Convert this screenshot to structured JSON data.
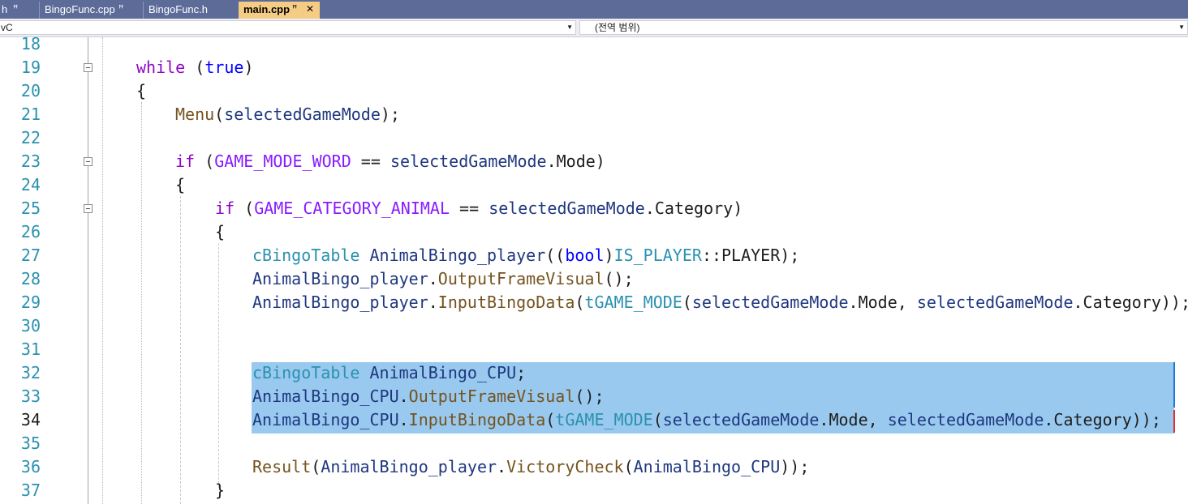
{
  "tabs": [
    {
      "label": "h",
      "pinned": true
    },
    {
      "label": "BingoFunc.cpp",
      "pinned": true
    },
    {
      "label": "BingoFunc.h",
      "pinned": false
    },
    {
      "label": "main.cpp",
      "pinned": true,
      "active": true,
      "close": "✕"
    }
  ],
  "navbar": {
    "scope_left": "vC",
    "scope_right": "(전역 범위)"
  },
  "colors": {
    "keyword": "#8f08c4",
    "keyword_blue": "#0000ff",
    "function": "#74531f",
    "type": "#2b91af",
    "macro": "#8a1bff",
    "variable": "#1f377f",
    "selection": "#99c9ef",
    "tab_active": "#f5cc84",
    "tab_bar": "#5d6b99"
  },
  "editor": {
    "current_line": "34",
    "lines": [
      {
        "num": "18",
        "tokens": []
      },
      {
        "num": "19",
        "tokens": [
          {
            "t": "while",
            "c": "kw"
          },
          {
            "t": " ("
          },
          {
            "t": "true",
            "c": "kwb"
          },
          {
            "t": ")"
          }
        ]
      },
      {
        "num": "20",
        "tokens": [
          {
            "t": "{"
          }
        ]
      },
      {
        "num": "21",
        "tokens": [
          {
            "t": "Menu",
            "c": "fn"
          },
          {
            "t": "("
          },
          {
            "t": "selectedGameMode",
            "c": "var"
          },
          {
            "t": ");"
          }
        ]
      },
      {
        "num": "22",
        "tokens": []
      },
      {
        "num": "23",
        "tokens": [
          {
            "t": "if",
            "c": "kw"
          },
          {
            "t": " ("
          },
          {
            "t": "GAME_MODE_WORD",
            "c": "mac"
          },
          {
            "t": " == "
          },
          {
            "t": "selectedGameMode",
            "c": "var"
          },
          {
            "t": ".Mode)"
          }
        ]
      },
      {
        "num": "24",
        "tokens": [
          {
            "t": "{"
          }
        ]
      },
      {
        "num": "25",
        "tokens": [
          {
            "t": "if",
            "c": "kw"
          },
          {
            "t": " ("
          },
          {
            "t": "GAME_CATEGORY_ANIMAL",
            "c": "mac"
          },
          {
            "t": " == "
          },
          {
            "t": "selectedGameMode",
            "c": "var"
          },
          {
            "t": ".Category)"
          }
        ]
      },
      {
        "num": "26",
        "tokens": [
          {
            "t": "{"
          }
        ]
      },
      {
        "num": "27",
        "tokens": [
          {
            "t": "cBingoTable",
            "c": "typ"
          },
          {
            "t": " "
          },
          {
            "t": "AnimalBingo_player",
            "c": "var"
          },
          {
            "t": "(("
          },
          {
            "t": "bool",
            "c": "kwb"
          },
          {
            "t": ")"
          },
          {
            "t": "IS_PLAYER",
            "c": "typ"
          },
          {
            "t": "::PLAYER);"
          }
        ]
      },
      {
        "num": "28",
        "tokens": [
          {
            "t": "AnimalBingo_player",
            "c": "var"
          },
          {
            "t": "."
          },
          {
            "t": "OutputFrameVisual",
            "c": "fn"
          },
          {
            "t": "();"
          }
        ]
      },
      {
        "num": "29",
        "tokens": [
          {
            "t": "AnimalBingo_player",
            "c": "var"
          },
          {
            "t": "."
          },
          {
            "t": "InputBingoData",
            "c": "fn"
          },
          {
            "t": "("
          },
          {
            "t": "tGAME_MODE",
            "c": "typ"
          },
          {
            "t": "("
          },
          {
            "t": "selectedGameMode",
            "c": "var"
          },
          {
            "t": ".Mode, "
          },
          {
            "t": "selectedGameMode",
            "c": "var"
          },
          {
            "t": ".Category));"
          }
        ]
      },
      {
        "num": "30",
        "tokens": []
      },
      {
        "num": "31",
        "tokens": []
      },
      {
        "num": "32",
        "tokens": [
          {
            "t": "cBingoTable",
            "c": "typ"
          },
          {
            "t": " "
          },
          {
            "t": "AnimalBingo_CPU",
            "c": "var"
          },
          {
            "t": ";"
          }
        ]
      },
      {
        "num": "33",
        "tokens": [
          {
            "t": "AnimalBingo_CPU",
            "c": "var"
          },
          {
            "t": "."
          },
          {
            "t": "OutputFrameVisual",
            "c": "fn"
          },
          {
            "t": "();"
          }
        ]
      },
      {
        "num": "34",
        "tokens": [
          {
            "t": "AnimalBingo_CPU",
            "c": "var"
          },
          {
            "t": "."
          },
          {
            "t": "InputBingoData",
            "c": "fn"
          },
          {
            "t": "("
          },
          {
            "t": "tGAME_MODE",
            "c": "typ"
          },
          {
            "t": "("
          },
          {
            "t": "selectedGameMode",
            "c": "var"
          },
          {
            "t": ".Mode, "
          },
          {
            "t": "selectedGameMode",
            "c": "var"
          },
          {
            "t": ".Category));"
          }
        ]
      },
      {
        "num": "35",
        "tokens": []
      },
      {
        "num": "36",
        "tokens": [
          {
            "t": "Result",
            "c": "fn"
          },
          {
            "t": "("
          },
          {
            "t": "AnimalBingo_player",
            "c": "var"
          },
          {
            "t": "."
          },
          {
            "t": "VictoryCheck",
            "c": "fn"
          },
          {
            "t": "("
          },
          {
            "t": "AnimalBingo_CPU",
            "c": "var"
          },
          {
            "t": "));"
          }
        ]
      },
      {
        "num": "37",
        "tokens": [
          {
            "t": "}"
          }
        ]
      }
    ]
  }
}
